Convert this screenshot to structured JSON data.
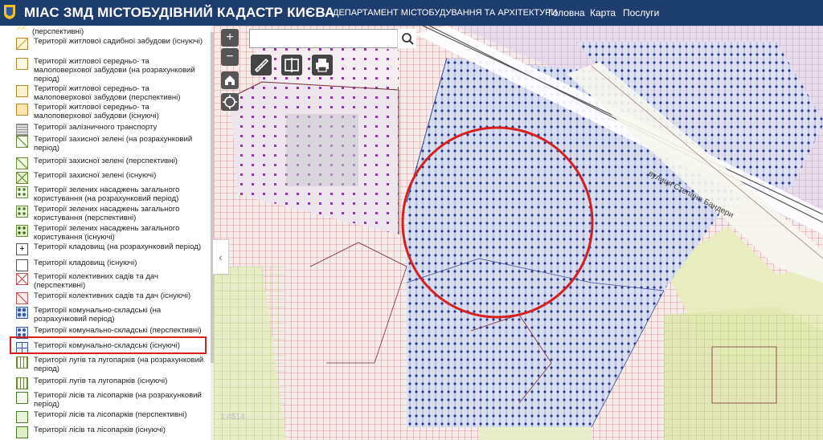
{
  "header": {
    "title": "МІАС ЗМД МІСТОБУДІВНИЙ КАДАСТР КИЄВА",
    "department": "ДЕПАРТАМЕНТ МІСТОБУДУВАННЯ ТА АРХІТЕКТУРИ",
    "nav": [
      "Головна",
      "Карта",
      "Послуги"
    ],
    "bar_color": "#1d3d6e"
  },
  "legend": {
    "items": [
      {
        "label": "(перспективні)"
      },
      {
        "label": "Території житлової садибної забудови (існуючі)"
      },
      {
        "label": "Території житлової середньо- та малоповерхової забудови (на розрахунковий період)"
      },
      {
        "label": "Території житлової середньо- та малоповерхової забудови (перспективні)"
      },
      {
        "label": "Території житлової середньо- та малоповерхової забудови (існуючі)"
      },
      {
        "label": "Території залізничного транспорту"
      },
      {
        "label": "Території захисної зелені (на розрахунковий період)"
      },
      {
        "label": "Території захисної зелені (перспективні)"
      },
      {
        "label": "Території захисної зелені (існуючі)"
      },
      {
        "label": "Території зелених насаджень загального користування (на розрахунковий період)"
      },
      {
        "label": "Території зелених насаджень загального користування (перспективні)"
      },
      {
        "label": "Території зелених насаджень загального користування (існуючі)"
      },
      {
        "label": "Території кладовищ (на розрахунковий період)"
      },
      {
        "label": "Території кладовищ (існуючі)"
      },
      {
        "label": "Території колективних садів та дач (перспективні)"
      },
      {
        "label": "Території колективних садів та дач (існуючі)"
      },
      {
        "label": "Території комунально-складські (на розрахунковий період)"
      },
      {
        "label": "Території комунально-складські (перспективні)"
      },
      {
        "label": "Території комунально-складські (існуючі)"
      },
      {
        "label": "Території лугів та лугопарків (на розрахунковий період)"
      },
      {
        "label": "Території лугів та лугопарків (існуючі)"
      },
      {
        "label": "Території лісів та лісопарків (на розрахунковий період)"
      },
      {
        "label": "Території лісів та лісопарків (перспективні)"
      },
      {
        "label": "Території лісів та лісопарків (існуючі)"
      }
    ],
    "highlighted_item": "Території комунально-складські (існуючі)"
  },
  "map": {
    "street_label": "вулиця Степана Бандери",
    "scale_text": "1:4514",
    "highlight_color": "#d62020",
    "icons": [
      "zoom-in-icon",
      "zoom-out-icon",
      "home-icon",
      "locate-icon",
      "search-icon",
      "measure-icon",
      "compare-icon",
      "print-icon",
      "chevron-left-icon"
    ]
  }
}
